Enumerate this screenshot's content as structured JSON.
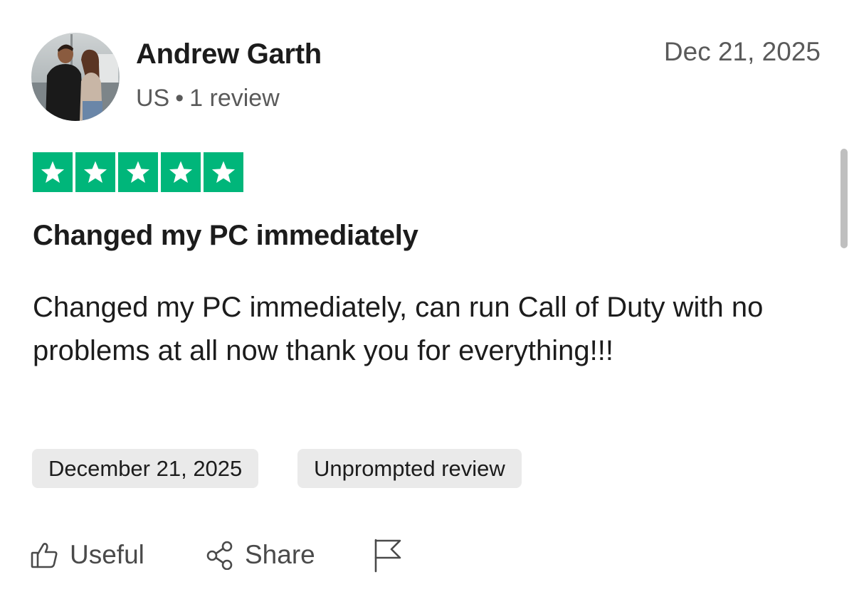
{
  "review": {
    "author": {
      "name": "Andrew Garth",
      "country": "US",
      "separator": "•",
      "review_count": "1 review",
      "avatar": "user-photo-avatar"
    },
    "date": "Dec 21, 2025",
    "rating": {
      "stars": 5,
      "max": 5,
      "star_color": "#00b67a"
    },
    "title": "Changed my PC immediately",
    "body": "Changed my PC immediately, can run Call of Duty with no problems at all now thank you for everything!!!",
    "tags": {
      "experience_date": "December 21, 2025",
      "review_type": "Unprompted review"
    },
    "actions": {
      "useful_label": "Useful",
      "useful_icon": "thumbs-up-icon",
      "share_label": "Share",
      "share_icon": "share-icon",
      "report_icon": "flag-icon"
    }
  },
  "colors": {
    "text_primary": "#1c1c1c",
    "text_secondary": "#5a5a5a",
    "tag_background": "#eaeaea",
    "star_green": "#00b67a"
  }
}
